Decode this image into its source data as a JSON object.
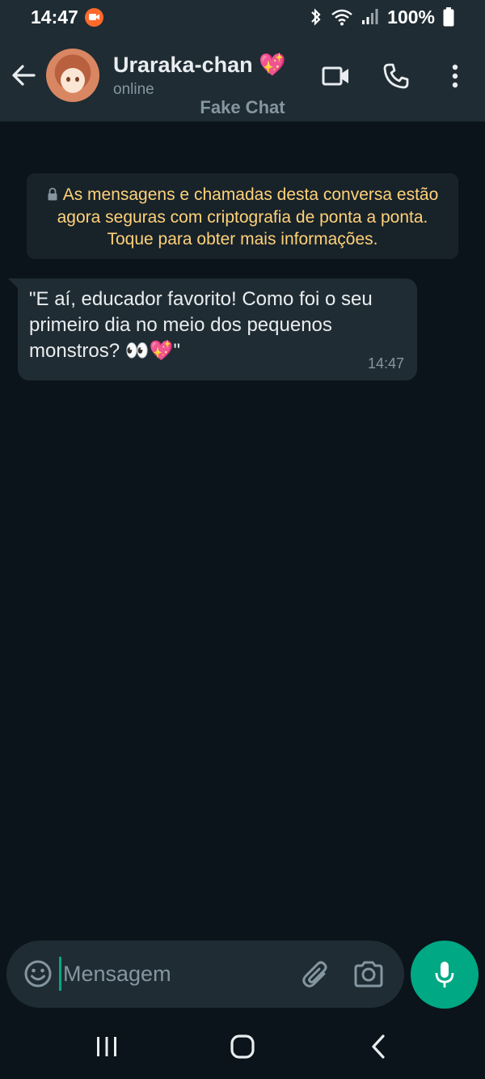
{
  "status_bar": {
    "time": "14:47",
    "battery": "100%",
    "icons": [
      "screen-record-icon",
      "bluetooth-icon",
      "wifi-icon",
      "signal-icon",
      "battery-icon"
    ]
  },
  "header": {
    "contact_name": "Uraraka-chan",
    "name_emoji": "💖",
    "contact_status": "online",
    "watermark": "Fake Chat",
    "icons": [
      "back-arrow-icon",
      "avatar",
      "video-call-icon",
      "phone-icon",
      "more-vert-icon"
    ]
  },
  "chat": {
    "encryption_notice": "As mensagens e chamadas desta conversa estão agora seguras com criptografia de ponta a ponta. Toque para obter mais informações.",
    "messages": [
      {
        "direction": "incoming",
        "text": "\"E aí, educador favorito! Como foi o seu primeiro dia no meio dos pequenos monstros? 👀💖\"",
        "time": "14:47"
      }
    ]
  },
  "input_bar": {
    "placeholder": "Mensagem",
    "value": "",
    "icons": [
      "emoji-icon",
      "attach-icon",
      "camera-icon",
      "mic-icon"
    ]
  },
  "nav_bar": {
    "icons": [
      "recents-icon",
      "home-icon",
      "back-icon"
    ]
  },
  "colors": {
    "background": "#0b141a",
    "header": "#1f2c34",
    "bubble_incoming": "#202c33",
    "encryption_text": "#ffd279",
    "accent": "#00a884",
    "secondary_text": "#8696a0"
  }
}
